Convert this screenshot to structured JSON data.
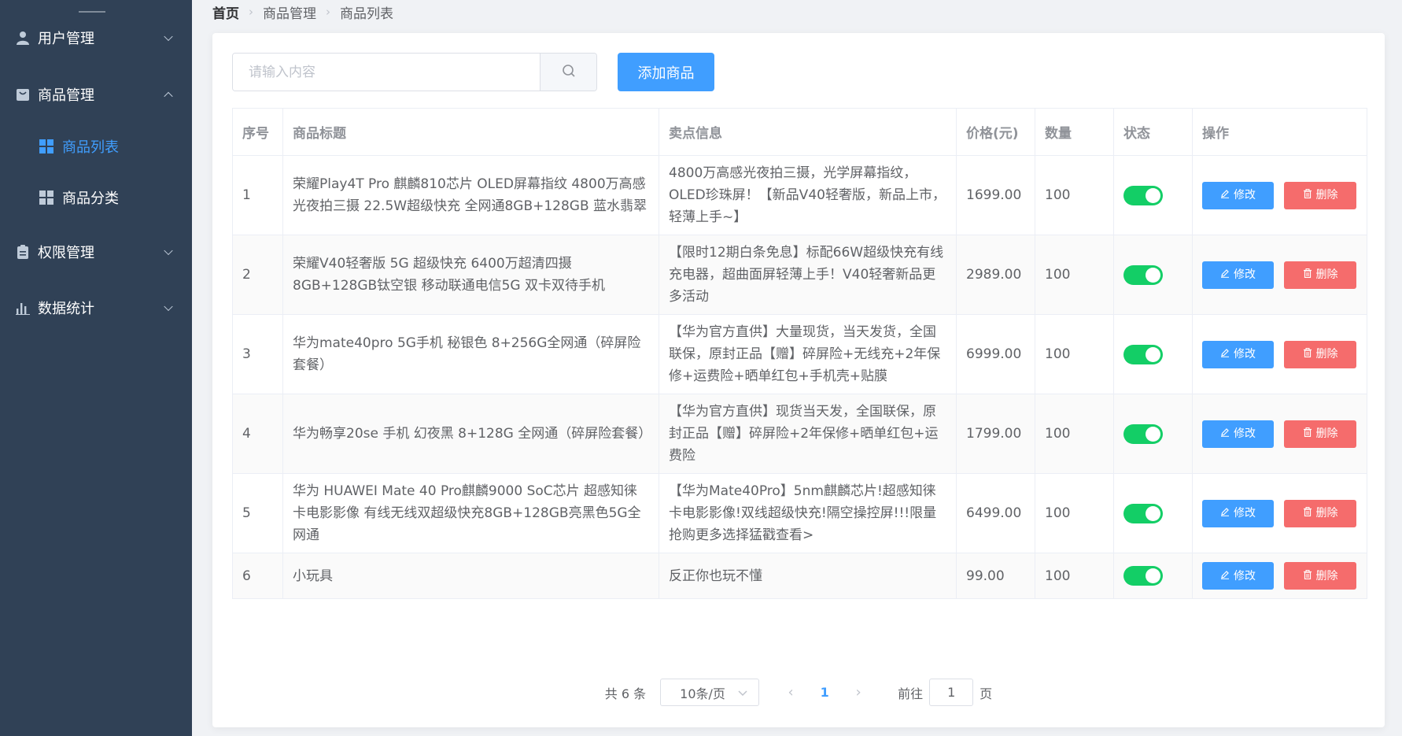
{
  "sidebar": {
    "menus": [
      {
        "label": "用户管理",
        "icon": "user-icon",
        "expanded": false
      },
      {
        "label": "商品管理",
        "icon": "bag-icon",
        "expanded": true
      },
      {
        "label": "权限管理",
        "icon": "clipboard-icon",
        "expanded": false
      },
      {
        "label": "数据统计",
        "icon": "bar-chart-icon",
        "expanded": false
      }
    ],
    "sub_items": [
      {
        "label": "商品列表",
        "active": true
      },
      {
        "label": "商品分类",
        "active": false
      }
    ]
  },
  "breadcrumb": [
    "首页",
    "商品管理",
    "商品列表"
  ],
  "search": {
    "placeholder": "请输入内容",
    "value": ""
  },
  "add_button": "添加商品",
  "table": {
    "headers": [
      "序号",
      "商品标题",
      "卖点信息",
      "价格(元)",
      "数量",
      "状态",
      "操作"
    ],
    "rows": [
      {
        "index": "1",
        "title": "荣耀Play4T Pro 麒麟810芯片 OLED屏幕指纹 4800万高感光夜拍三摄 22.5W超级快充 全网通8GB+128GB 蓝水翡翠",
        "selling": "4800万高感光夜拍三摄，光学屏幕指纹，OLED珍珠屏！【新品V40轻奢版，新品上市，轻薄上手~】",
        "price": "1699.00",
        "qty": "100",
        "status": true
      },
      {
        "index": "2",
        "title": "荣耀V40轻奢版 5G 超级快充 6400万超清四摄 8GB+128GB钛空银 移动联通电信5G 双卡双待手机",
        "selling": "【限时12期白条免息】标配66W超级快充有线充电器，超曲面屏轻薄上手！V40轻奢新品更多活动",
        "price": "2989.00",
        "qty": "100",
        "status": true
      },
      {
        "index": "3",
        "title": "华为mate40pro 5G手机 秘银色 8+256G全网通（碎屏险套餐）",
        "selling": "【华为官方直供】大量现货，当天发货，全国联保，原封正品【赠】碎屏险+无线充+2年保修+运费险+晒单红包+手机壳+贴膜",
        "price": "6999.00",
        "qty": "100",
        "status": true
      },
      {
        "index": "4",
        "title": "华为畅享20se 手机 幻夜黑 8+128G 全网通（碎屏险套餐）",
        "selling": "【华为官方直供】现货当天发，全国联保，原封正品【赠】碎屏险+2年保修+晒单红包+运费险",
        "price": "1799.00",
        "qty": "100",
        "status": true
      },
      {
        "index": "5",
        "title": "华为 HUAWEI Mate 40 Pro麒麟9000 SoC芯片 超感知徕卡电影影像 有线无线双超级快充8GB+128GB亮黑色5G全网通",
        "selling": "【华为Mate40Pro】5nm麒麟芯片!超感知徕卡电影影像!双线超级快充!隔空操控屏!!!限量抢购更多选择猛戳查看>",
        "price": "6499.00",
        "qty": "100",
        "status": true
      },
      {
        "index": "6",
        "title": "小玩具",
        "selling": "反正你也玩不懂",
        "price": "99.00",
        "qty": "100",
        "status": true
      }
    ],
    "edit_label": "修改",
    "delete_label": "删除"
  },
  "pagination": {
    "total": "共 6 条",
    "page_size": "10条/页",
    "current_page": "1",
    "goto_prefix": "前往",
    "goto_value": "1",
    "goto_suffix": "页"
  },
  "colors": {
    "sidebar_bg": "#304156",
    "primary": "#409eff",
    "danger": "#f56c6c",
    "switch_on": "#13ce66"
  }
}
